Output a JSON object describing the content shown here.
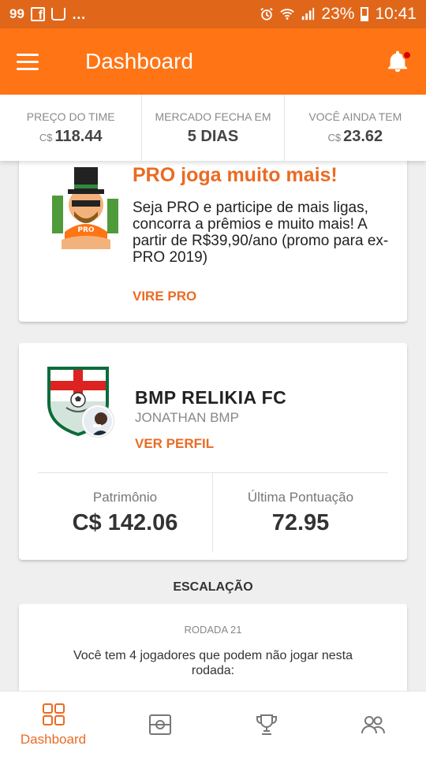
{
  "status_bar": {
    "left_num": "99",
    "battery": "23%",
    "time": "10:41"
  },
  "app_bar": {
    "title": "Dashboard"
  },
  "stats": [
    {
      "label": "PREÇO DO TIME",
      "prefix": "C$",
      "value": "118.44"
    },
    {
      "label": "MERCADO FECHA EM",
      "prefix": "",
      "value": "5 DIAS"
    },
    {
      "label": "VOCÊ AINDA TEM",
      "prefix": "C$",
      "value": "23.62"
    }
  ],
  "pro_card": {
    "title": "PRO joga muito mais!",
    "text": "Seja PRO e participe de mais ligas, concorra a prêmios e muito mais! A partir de R$39,90/ano (promo para ex-PRO 2019)",
    "link": "VIRE PRO"
  },
  "team_card": {
    "name": "BMP RELIKIA  FC",
    "owner": "JONATHAN BMP",
    "link": "VER PERFIL",
    "patrimonio_label": "Patrimônio",
    "patrimonio_value": "C$ 142.06",
    "pontuacao_label": "Última Pontuação",
    "pontuacao_value": "72.95"
  },
  "lineup": {
    "heading": "ESCALAÇÃO",
    "round": "RODADA 21",
    "message": "Você tem 4 jogadores que podem não jogar nesta rodada:"
  },
  "bottom_nav": {
    "items": [
      {
        "icon": "grid-icon",
        "label": "Dashboard"
      },
      {
        "icon": "field-icon",
        "label": ""
      },
      {
        "icon": "trophy-icon",
        "label": ""
      },
      {
        "icon": "users-icon",
        "label": ""
      }
    ]
  },
  "colors": {
    "status_bar": "#e0671a",
    "app_bar": "#ff7414",
    "accent": "#ea6b23",
    "background": "#efefef"
  }
}
